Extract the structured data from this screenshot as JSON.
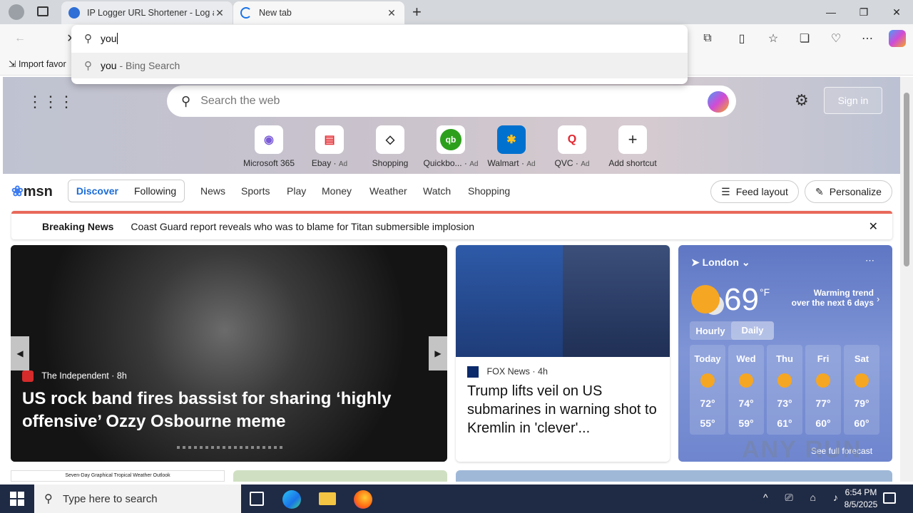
{
  "browser": {
    "tabs": [
      {
        "title": "IP Logger URL Shortener - Log an"
      },
      {
        "title": "New tab"
      }
    ],
    "address": {
      "query": "you",
      "suggestion_query": "you",
      "suggestion_source": "Bing Search"
    },
    "favbar": {
      "import_label": "Import favor"
    }
  },
  "msn": {
    "search_placeholder": "Search the web",
    "sign_in": "Sign in",
    "shortcuts": [
      {
        "label": "Microsoft 365",
        "ad": ""
      },
      {
        "label": "Ebay",
        "ad": "Ad"
      },
      {
        "label": "Shopping",
        "ad": ""
      },
      {
        "label": "Quickbo...",
        "ad": "Ad"
      },
      {
        "label": "Walmart",
        "ad": "Ad"
      },
      {
        "label": "QVC",
        "ad": "Ad"
      },
      {
        "label": "Add shortcut",
        "ad": ""
      }
    ],
    "logo": "msn",
    "tabs": {
      "discover": "Discover",
      "following": "Following"
    },
    "nav": [
      "News",
      "Sports",
      "Play",
      "Money",
      "Weather",
      "Watch",
      "Shopping"
    ],
    "feed_layout": "Feed layout",
    "personalize": "Personalize",
    "breaking": {
      "label": "Breaking News",
      "headline": "Coast Guard report reveals who was to blame for Titan submersible implosion"
    },
    "hero_story": {
      "source": "The Independent",
      "age": "8h",
      "headline": "US rock band fires bassist for sharing ‘highly offensive’ Ozzy Osbourne meme"
    },
    "side_story": {
      "source": "FOX News",
      "age": "4h",
      "headline": "Trump lifts veil on US submarines in warning shot to Kremlin in 'clever'..."
    },
    "weather": {
      "city": "London",
      "temp": "69",
      "unit": "°F",
      "trend_title": "Warming trend",
      "trend_sub": "over the next 6 days",
      "toggle": [
        "Hourly",
        "Daily"
      ],
      "days": [
        {
          "day": "Today",
          "hi": "72°",
          "lo": "55°"
        },
        {
          "day": "Wed",
          "hi": "74°",
          "lo": "59°"
        },
        {
          "day": "Thu",
          "hi": "73°",
          "lo": "61°"
        },
        {
          "day": "Fri",
          "hi": "77°",
          "lo": "60°"
        },
        {
          "day": "Sat",
          "hi": "79°",
          "lo": "60°"
        }
      ],
      "forecast_link": "See full forecast"
    },
    "tropical_title": "Seven-Day Graphical Tropical Weather Outlook"
  },
  "taskbar": {
    "search_placeholder": "Type here to search",
    "time": "6:54 PM",
    "date": "8/5/2025"
  },
  "watermark": "ANY RUN"
}
